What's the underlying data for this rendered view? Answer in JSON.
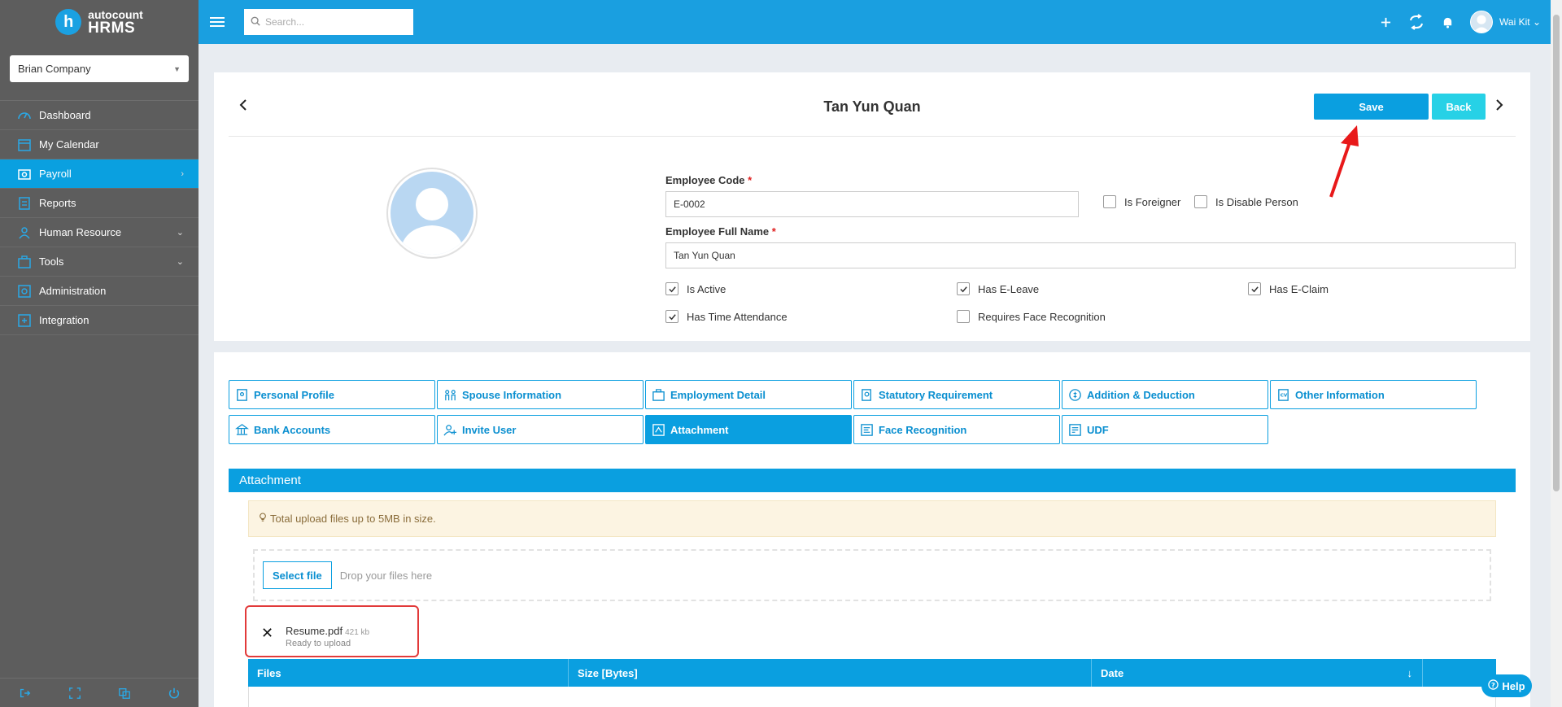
{
  "app": {
    "logo_line1": "autocount",
    "logo_line2": "HRMS",
    "company": "Brian Company"
  },
  "sidebar": {
    "items": [
      {
        "label": "Dashboard",
        "icon": "dashboard-icon"
      },
      {
        "label": "My Calendar",
        "icon": "calendar-icon"
      },
      {
        "label": "Payroll",
        "icon": "payroll-icon",
        "active": true
      },
      {
        "label": "Reports",
        "icon": "reports-icon"
      },
      {
        "label": "Human Resource",
        "icon": "human-resource-icon"
      },
      {
        "label": "Tools",
        "icon": "tools-icon"
      },
      {
        "label": "Administration",
        "icon": "administration-icon"
      },
      {
        "label": "Integration",
        "icon": "integration-icon"
      }
    ]
  },
  "topbar": {
    "search_placeholder": "Search...",
    "user_name": "Wai Kit"
  },
  "employee": {
    "title": "Tan Yun Quan",
    "save_label": "Save",
    "back_label": "Back",
    "code_label": "Employee Code",
    "code_value": "E-0002",
    "fullname_label": "Employee Full Name",
    "fullname_value": "Tan Yun Quan",
    "required_mark": "*",
    "checkboxes": {
      "is_foreigner": {
        "label": "Is Foreigner",
        "checked": false
      },
      "is_disable_person": {
        "label": "Is Disable Person",
        "checked": false
      },
      "is_active": {
        "label": "Is Active",
        "checked": true
      },
      "has_eleave": {
        "label": "Has E-Leave",
        "checked": true
      },
      "has_eclaim": {
        "label": "Has E-Claim",
        "checked": true
      },
      "has_time_attendance": {
        "label": "Has Time Attendance",
        "checked": true
      },
      "requires_face_recognition": {
        "label": "Requires Face Recognition",
        "checked": false
      }
    }
  },
  "tabs": [
    {
      "label": "Personal Profile"
    },
    {
      "label": "Spouse Information"
    },
    {
      "label": "Employment Detail"
    },
    {
      "label": "Statutory Requirement"
    },
    {
      "label": "Addition & Deduction"
    },
    {
      "label": "Other Information"
    },
    {
      "label": "Bank Accounts"
    },
    {
      "label": "Invite User"
    },
    {
      "label": "Attachment",
      "active": true
    },
    {
      "label": "Face Recognition"
    },
    {
      "label": "UDF"
    }
  ],
  "attachment": {
    "header": "Attachment",
    "notice": "Total upload files up to 5MB in size.",
    "select_file_label": "Select file",
    "drop_text": "Drop your files here",
    "file": {
      "name": "Resume.pdf",
      "size": "421 kb",
      "status": "Ready to upload"
    },
    "table_columns": [
      "Files",
      "Size [Bytes]",
      "Date",
      ""
    ]
  },
  "help_label": "Help",
  "colors": {
    "primary": "#0a9fe0",
    "sidebar_bg": "#5d5d5d",
    "back_button": "#27d1e6",
    "required": "#e02020",
    "highlight": "#e23a3a"
  }
}
